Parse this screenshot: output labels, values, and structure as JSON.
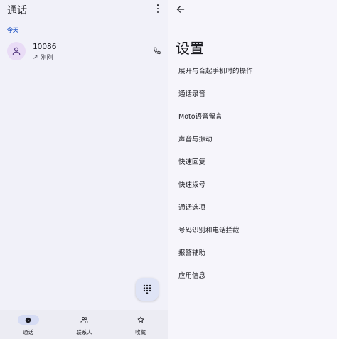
{
  "calls": {
    "title": "通话",
    "section_today": "今天",
    "entry": {
      "number": "10086",
      "direction_arrow": "↗",
      "time": "刚刚"
    },
    "fab_icon": "dialpad-icon"
  },
  "bottom_nav": {
    "items": [
      {
        "label": "通话",
        "icon": "clock-icon",
        "active": true
      },
      {
        "label": "联系人",
        "icon": "people-icon",
        "active": false
      },
      {
        "label": "收藏",
        "icon": "star-icon",
        "active": false
      }
    ]
  },
  "settings": {
    "title": "设置",
    "items": [
      "展开与合起手机时的操作",
      "通话录音",
      "Moto语音留言",
      "声音与振动",
      "快速回复",
      "快速拨号",
      "通话选项",
      "号码识别和电话拦截",
      "报警辅助",
      "应用信息"
    ]
  },
  "colors": {
    "accent_blue": "#2a5cc7",
    "avatar_bg": "#e9dcf6",
    "active_pill": "#d6dcf4"
  }
}
